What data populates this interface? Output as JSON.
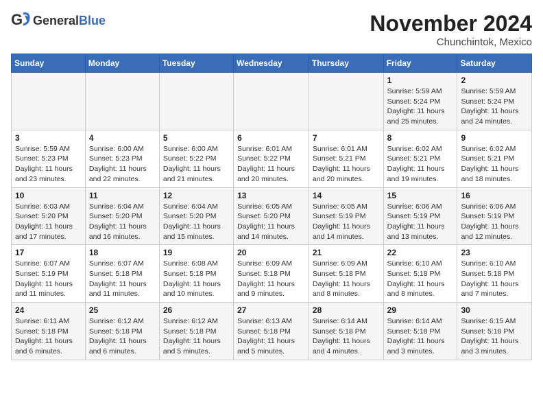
{
  "header": {
    "logo_general": "General",
    "logo_blue": "Blue",
    "month_title": "November 2024",
    "location": "Chunchintok, Mexico"
  },
  "weekdays": [
    "Sunday",
    "Monday",
    "Tuesday",
    "Wednesday",
    "Thursday",
    "Friday",
    "Saturday"
  ],
  "weeks": [
    [
      {
        "day": "",
        "info": ""
      },
      {
        "day": "",
        "info": ""
      },
      {
        "day": "",
        "info": ""
      },
      {
        "day": "",
        "info": ""
      },
      {
        "day": "",
        "info": ""
      },
      {
        "day": "1",
        "info": "Sunrise: 5:59 AM\nSunset: 5:24 PM\nDaylight: 11 hours\nand 25 minutes."
      },
      {
        "day": "2",
        "info": "Sunrise: 5:59 AM\nSunset: 5:24 PM\nDaylight: 11 hours\nand 24 minutes."
      }
    ],
    [
      {
        "day": "3",
        "info": "Sunrise: 5:59 AM\nSunset: 5:23 PM\nDaylight: 11 hours\nand 23 minutes."
      },
      {
        "day": "4",
        "info": "Sunrise: 6:00 AM\nSunset: 5:23 PM\nDaylight: 11 hours\nand 22 minutes."
      },
      {
        "day": "5",
        "info": "Sunrise: 6:00 AM\nSunset: 5:22 PM\nDaylight: 11 hours\nand 21 minutes."
      },
      {
        "day": "6",
        "info": "Sunrise: 6:01 AM\nSunset: 5:22 PM\nDaylight: 11 hours\nand 20 minutes."
      },
      {
        "day": "7",
        "info": "Sunrise: 6:01 AM\nSunset: 5:21 PM\nDaylight: 11 hours\nand 20 minutes."
      },
      {
        "day": "8",
        "info": "Sunrise: 6:02 AM\nSunset: 5:21 PM\nDaylight: 11 hours\nand 19 minutes."
      },
      {
        "day": "9",
        "info": "Sunrise: 6:02 AM\nSunset: 5:21 PM\nDaylight: 11 hours\nand 18 minutes."
      }
    ],
    [
      {
        "day": "10",
        "info": "Sunrise: 6:03 AM\nSunset: 5:20 PM\nDaylight: 11 hours\nand 17 minutes."
      },
      {
        "day": "11",
        "info": "Sunrise: 6:04 AM\nSunset: 5:20 PM\nDaylight: 11 hours\nand 16 minutes."
      },
      {
        "day": "12",
        "info": "Sunrise: 6:04 AM\nSunset: 5:20 PM\nDaylight: 11 hours\nand 15 minutes."
      },
      {
        "day": "13",
        "info": "Sunrise: 6:05 AM\nSunset: 5:20 PM\nDaylight: 11 hours\nand 14 minutes."
      },
      {
        "day": "14",
        "info": "Sunrise: 6:05 AM\nSunset: 5:19 PM\nDaylight: 11 hours\nand 14 minutes."
      },
      {
        "day": "15",
        "info": "Sunrise: 6:06 AM\nSunset: 5:19 PM\nDaylight: 11 hours\nand 13 minutes."
      },
      {
        "day": "16",
        "info": "Sunrise: 6:06 AM\nSunset: 5:19 PM\nDaylight: 11 hours\nand 12 minutes."
      }
    ],
    [
      {
        "day": "17",
        "info": "Sunrise: 6:07 AM\nSunset: 5:19 PM\nDaylight: 11 hours\nand 11 minutes."
      },
      {
        "day": "18",
        "info": "Sunrise: 6:07 AM\nSunset: 5:18 PM\nDaylight: 11 hours\nand 11 minutes."
      },
      {
        "day": "19",
        "info": "Sunrise: 6:08 AM\nSunset: 5:18 PM\nDaylight: 11 hours\nand 10 minutes."
      },
      {
        "day": "20",
        "info": "Sunrise: 6:09 AM\nSunset: 5:18 PM\nDaylight: 11 hours\nand 9 minutes."
      },
      {
        "day": "21",
        "info": "Sunrise: 6:09 AM\nSunset: 5:18 PM\nDaylight: 11 hours\nand 8 minutes."
      },
      {
        "day": "22",
        "info": "Sunrise: 6:10 AM\nSunset: 5:18 PM\nDaylight: 11 hours\nand 8 minutes."
      },
      {
        "day": "23",
        "info": "Sunrise: 6:10 AM\nSunset: 5:18 PM\nDaylight: 11 hours\nand 7 minutes."
      }
    ],
    [
      {
        "day": "24",
        "info": "Sunrise: 6:11 AM\nSunset: 5:18 PM\nDaylight: 11 hours\nand 6 minutes."
      },
      {
        "day": "25",
        "info": "Sunrise: 6:12 AM\nSunset: 5:18 PM\nDaylight: 11 hours\nand 6 minutes."
      },
      {
        "day": "26",
        "info": "Sunrise: 6:12 AM\nSunset: 5:18 PM\nDaylight: 11 hours\nand 5 minutes."
      },
      {
        "day": "27",
        "info": "Sunrise: 6:13 AM\nSunset: 5:18 PM\nDaylight: 11 hours\nand 5 minutes."
      },
      {
        "day": "28",
        "info": "Sunrise: 6:14 AM\nSunset: 5:18 PM\nDaylight: 11 hours\nand 4 minutes."
      },
      {
        "day": "29",
        "info": "Sunrise: 6:14 AM\nSunset: 5:18 PM\nDaylight: 11 hours\nand 3 minutes."
      },
      {
        "day": "30",
        "info": "Sunrise: 6:15 AM\nSunset: 5:18 PM\nDaylight: 11 hours\nand 3 minutes."
      }
    ]
  ]
}
